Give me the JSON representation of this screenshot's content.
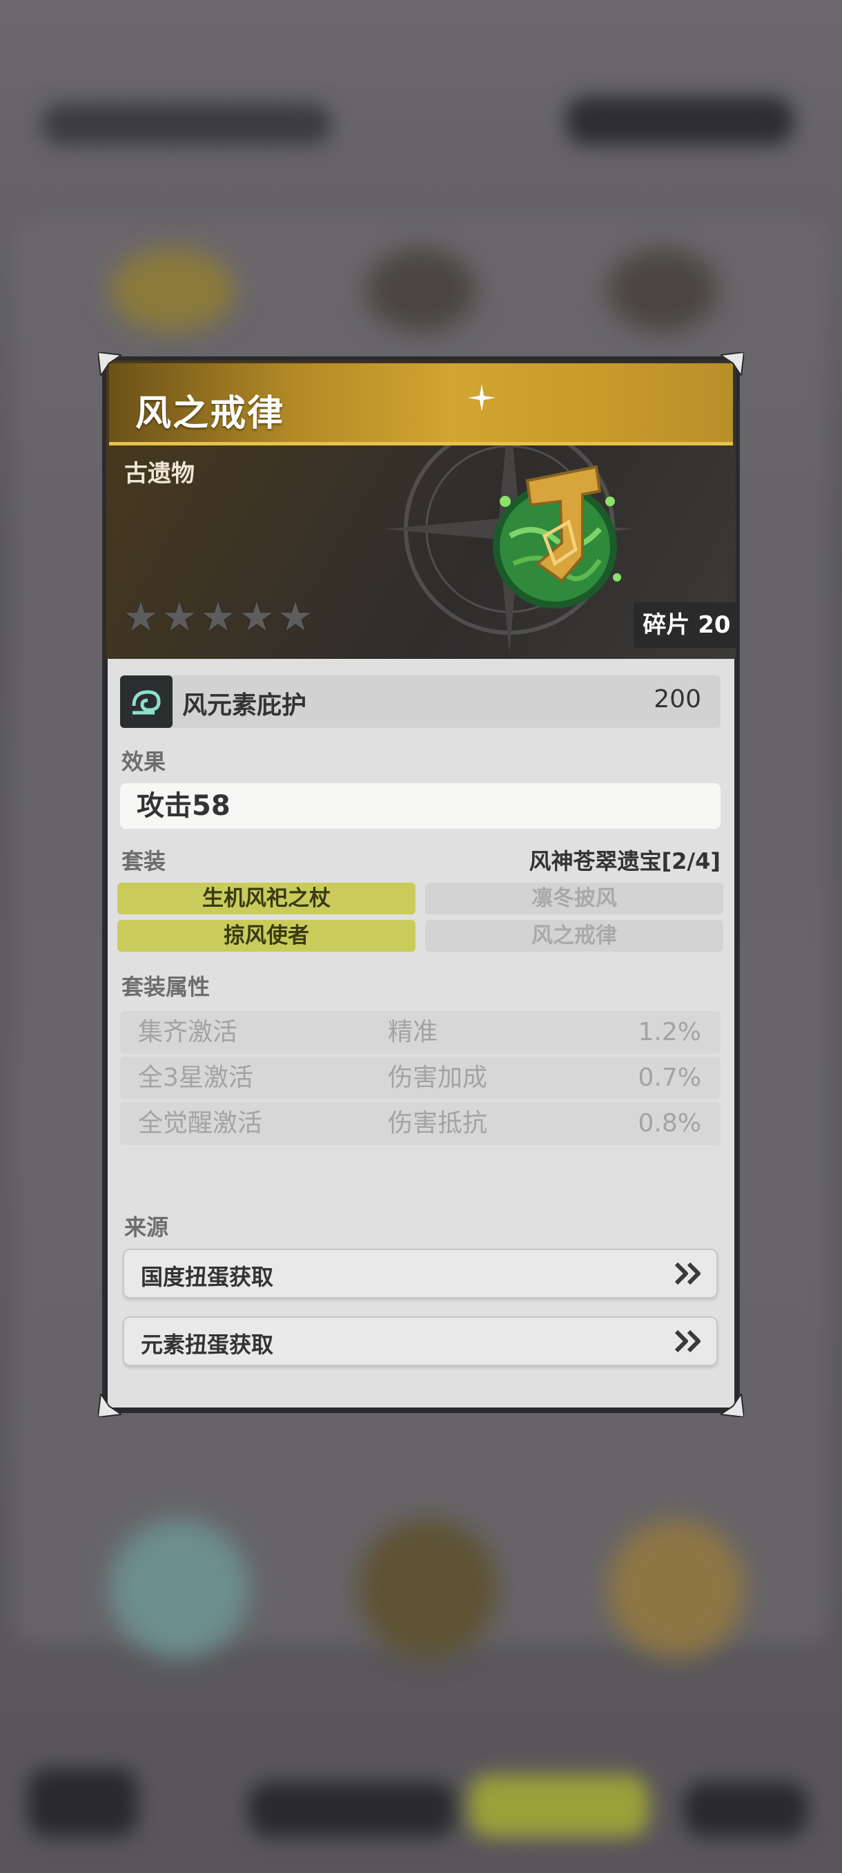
{
  "item": {
    "title": "风之戒律",
    "category": "古遗物",
    "rarity_stars_total": 5,
    "rarity_stars_filled": 0,
    "fragment_label": "碎片 20"
  },
  "main_stat": {
    "name": "风元素庇护",
    "value": "200",
    "icon": "wind-element-icon"
  },
  "effect": {
    "label": "效果",
    "value": "攻击58"
  },
  "set": {
    "label": "套装",
    "name": "风神苍翠遗宝[2/4]",
    "pieces": [
      {
        "name": "生机风祀之杖",
        "active": true
      },
      {
        "name": "凛冬披风",
        "active": false
      },
      {
        "name": "掠风使者",
        "active": true
      },
      {
        "name": "风之戒律",
        "active": false
      }
    ]
  },
  "set_attributes": {
    "label": "套装属性",
    "rows": [
      {
        "condition": "集齐激活",
        "attribute": "精准",
        "value": "1.2%"
      },
      {
        "condition": "全3星激活",
        "attribute": "伤害加成",
        "value": "0.7%"
      },
      {
        "condition": "全觉醒激活",
        "attribute": "伤害抵抗",
        "value": "0.8%"
      }
    ]
  },
  "source": {
    "label": "来源",
    "buttons": [
      {
        "label": "国度扭蛋获取",
        "icon": "double-chevron-right-icon"
      },
      {
        "label": "元素扭蛋获取",
        "icon": "double-chevron-right-icon"
      }
    ]
  },
  "colors": {
    "title_gold": "#c79a2a",
    "set_active": "#c9cc5b",
    "panel_bg": "#e0e0e0"
  }
}
